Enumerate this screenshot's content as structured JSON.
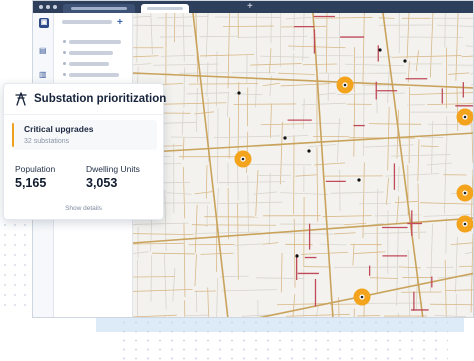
{
  "browser": {
    "new_tab_label": "+"
  },
  "panel": {
    "add_label": "+"
  },
  "card": {
    "title": "Substation prioritization",
    "highlight": {
      "title": "Critical upgrades",
      "subtitle": "32 substations"
    },
    "stats": [
      {
        "label": "Population",
        "value": "5,165"
      },
      {
        "label": "Dwelling Units",
        "value": "3,053"
      }
    ],
    "show_details_label": "Show details"
  },
  "colors": {
    "accent": "#f0a21e",
    "marker": "#f3a41c",
    "titlebar": "#2e3f5c",
    "road_major": "#c9a35c",
    "road_minor": "#d9b98a",
    "road_highlight": "#c04a5a"
  },
  "icons": {
    "card": "transmission-tower-icon",
    "rail": [
      "app-logo-icon",
      "buildings-icon",
      "bar-chart-icon"
    ]
  }
}
